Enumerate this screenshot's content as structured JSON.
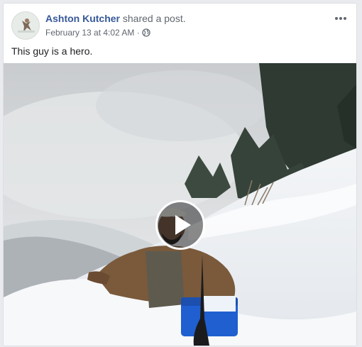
{
  "post": {
    "author": "Ashton Kutcher",
    "action": "shared a post.",
    "timestamp": "February 13 at 4:02 AM",
    "separator": "·",
    "privacy_icon": "globe-icon",
    "options_icon": "more-options-icon",
    "text": "This guy is a hero."
  },
  "media": {
    "type": "video",
    "play_icon": "play-icon"
  },
  "colors": {
    "link": "#365899",
    "secondary_text": "#606770",
    "primary_text": "#1c1e21",
    "background": "#e9ebee",
    "card": "#ffffff"
  }
}
